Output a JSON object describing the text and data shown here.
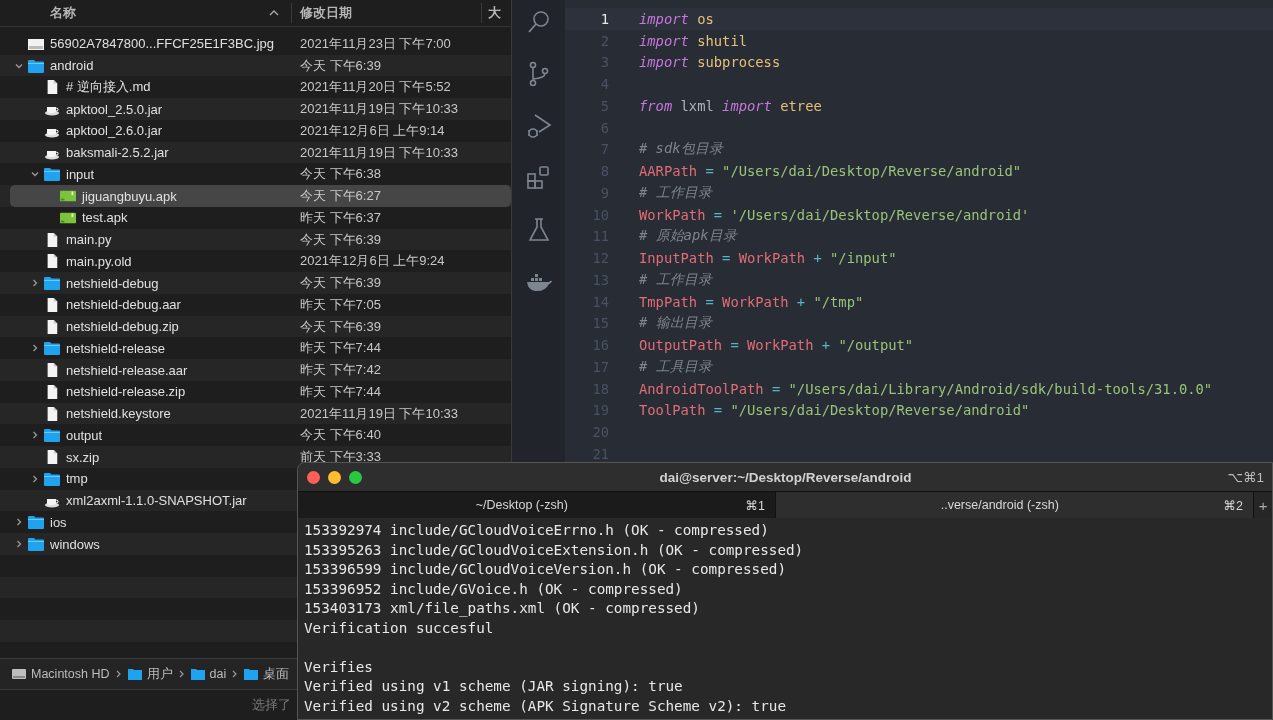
{
  "finder": {
    "columns": [
      {
        "label": "名称",
        "sorted": true
      },
      {
        "label": "修改日期",
        "sorted": false
      },
      {
        "label": "大",
        "sorted": false
      }
    ],
    "rows": [
      {
        "name": "56902A7847800...FFCF25E1F3BC.jpg",
        "date": "2021年11月23日 下午7:00",
        "kind": "image",
        "selected": false
      },
      {
        "name": "android",
        "date": "今天 下午6:39",
        "kind": "folder",
        "expanded": true,
        "selected": false,
        "children": [
          {
            "name": "# 逆向接入.md",
            "date": "2021年11月20日 下午5:52",
            "kind": "document",
            "selected": false
          },
          {
            "name": "apktool_2.5.0.jar",
            "date": "2021年11月19日 下午10:33",
            "kind": "jar",
            "selected": false
          },
          {
            "name": "apktool_2.6.0.jar",
            "date": "2021年12月6日 上午9:14",
            "kind": "jar",
            "selected": false
          },
          {
            "name": "baksmali-2.5.2.jar",
            "date": "2021年11月19日 下午10:33",
            "kind": "jar",
            "selected": false
          },
          {
            "name": "input",
            "date": "今天 下午6:38",
            "kind": "folder",
            "expanded": true,
            "selected": false,
            "children": [
              {
                "name": "jiguangbuyu.apk",
                "date": "今天 下午6:27",
                "kind": "apk",
                "selected": true
              },
              {
                "name": "test.apk",
                "date": "昨天 下午6:37",
                "kind": "apk",
                "selected": false
              }
            ]
          },
          {
            "name": "main.py",
            "date": "今天 下午6:39",
            "kind": "document",
            "selected": false
          },
          {
            "name": "main.py.old",
            "date": "2021年12月6日 上午9:24",
            "kind": "document",
            "selected": false
          },
          {
            "name": "netshield-debug",
            "date": "今天 下午6:39",
            "kind": "folder",
            "expanded": false,
            "selected": false
          },
          {
            "name": "netshield-debug.aar",
            "date": "昨天 下午7:05",
            "kind": "document",
            "selected": false
          },
          {
            "name": "netshield-debug.zip",
            "date": "今天 下午6:39",
            "kind": "document",
            "selected": false
          },
          {
            "name": "netshield-release",
            "date": "昨天 下午7:44",
            "kind": "folder",
            "expanded": false,
            "selected": false
          },
          {
            "name": "netshield-release.aar",
            "date": "昨天 下午7:42",
            "kind": "document",
            "selected": false
          },
          {
            "name": "netshield-release.zip",
            "date": "昨天 下午7:44",
            "kind": "document",
            "selected": false
          },
          {
            "name": "netshield.keystore",
            "date": "2021年11月19日 下午10:33",
            "kind": "document",
            "selected": false
          },
          {
            "name": "output",
            "date": "今天 下午6:40",
            "kind": "folder",
            "expanded": false,
            "selected": false
          },
          {
            "name": "sx.zip",
            "date": "前天 下午3:33",
            "kind": "document",
            "selected": false
          },
          {
            "name": "tmp",
            "kind": "folder",
            "expanded": false,
            "selected": false
          },
          {
            "name": "xml2axml-1.1.0-SNAPSHOT.jar",
            "kind": "jar",
            "selected": false
          }
        ]
      },
      {
        "name": "ios",
        "kind": "folder",
        "expanded": false,
        "selected": false
      },
      {
        "name": "windows",
        "kind": "folder",
        "expanded": false,
        "selected": false
      }
    ],
    "path_bar": [
      {
        "label": "Macintosh HD",
        "kind": "disk"
      },
      {
        "label": "用户",
        "kind": "folder"
      },
      {
        "label": "dai",
        "kind": "folder"
      },
      {
        "label": "桌面",
        "kind": "folder"
      }
    ],
    "status": "选择了"
  },
  "editor": {
    "lines": [
      {
        "number": "1",
        "current": true,
        "tokens": [
          {
            "kind": "kw",
            "text": "import"
          },
          {
            "kind": "mod",
            "text": " os"
          }
        ]
      },
      {
        "number": "2",
        "current": false,
        "tokens": [
          {
            "kind": "kw",
            "text": "import"
          },
          {
            "kind": "mod",
            "text": " shutil"
          }
        ]
      },
      {
        "number": "3",
        "current": false,
        "tokens": [
          {
            "kind": "kw",
            "text": "import"
          },
          {
            "kind": "mod",
            "text": " subprocess"
          }
        ]
      },
      {
        "number": "4",
        "current": false
      },
      {
        "number": "5",
        "current": false,
        "tokens": [
          {
            "kind": "kw",
            "text": "from"
          },
          {
            "kind": "plain",
            "text": " lxml "
          },
          {
            "kind": "kw",
            "text": "import"
          },
          {
            "kind": "mod",
            "text": " etree"
          }
        ]
      },
      {
        "number": "6",
        "current": false
      },
      {
        "number": "7",
        "current": false,
        "tokens": [
          {
            "kind": "comment",
            "text": "# sdk包目录"
          }
        ]
      },
      {
        "number": "8",
        "current": false,
        "tokens": [
          {
            "kind": "var",
            "text": "AARPath"
          },
          {
            "kind": "op",
            "text": " = "
          },
          {
            "kind": "str",
            "text": "\"/Users/dai/Desktop/Reverse/android\""
          }
        ]
      },
      {
        "number": "9",
        "current": false,
        "tokens": [
          {
            "kind": "comment",
            "text": "# 工作目录"
          }
        ]
      },
      {
        "number": "10",
        "current": false,
        "tokens": [
          {
            "kind": "var",
            "text": "WorkPath"
          },
          {
            "kind": "op",
            "text": " = "
          },
          {
            "kind": "str",
            "text": "'/Users/dai/Desktop/Reverse/android'"
          }
        ]
      },
      {
        "number": "11",
        "current": false,
        "tokens": [
          {
            "kind": "comment",
            "text": "# 原始apk目录"
          }
        ]
      },
      {
        "number": "12",
        "current": false,
        "tokens": [
          {
            "kind": "var",
            "text": "InputPath"
          },
          {
            "kind": "op",
            "text": " = "
          },
          {
            "kind": "var",
            "text": "WorkPath"
          },
          {
            "kind": "op",
            "text": " + "
          },
          {
            "kind": "str",
            "text": "\"/input\""
          }
        ]
      },
      {
        "number": "13",
        "current": false,
        "tokens": [
          {
            "kind": "comment",
            "text": "# 工作目录"
          }
        ]
      },
      {
        "number": "14",
        "current": false,
        "tokens": [
          {
            "kind": "var",
            "text": "TmpPath"
          },
          {
            "kind": "op",
            "text": " = "
          },
          {
            "kind": "var",
            "text": "WorkPath"
          },
          {
            "kind": "op",
            "text": " + "
          },
          {
            "kind": "str",
            "text": "\"/tmp\""
          }
        ]
      },
      {
        "number": "15",
        "current": false,
        "tokens": [
          {
            "kind": "comment",
            "text": "# 输出目录"
          }
        ]
      },
      {
        "number": "16",
        "current": false,
        "tokens": [
          {
            "kind": "var",
            "text": "OutputPath"
          },
          {
            "kind": "op",
            "text": " = "
          },
          {
            "kind": "var",
            "text": "WorkPath"
          },
          {
            "kind": "op",
            "text": " + "
          },
          {
            "kind": "str",
            "text": "\"/output\""
          }
        ]
      },
      {
        "number": "17",
        "current": false,
        "tokens": [
          {
            "kind": "comment",
            "text": "# 工具目录"
          }
        ]
      },
      {
        "number": "18",
        "current": false,
        "tokens": [
          {
            "kind": "var",
            "text": "AndroidToolPath"
          },
          {
            "kind": "op",
            "text": " = "
          },
          {
            "kind": "str",
            "text": "\"/Users/dai/Library/Android/sdk/build-tools/31.0.0\""
          }
        ]
      },
      {
        "number": "19",
        "current": false,
        "tokens": [
          {
            "kind": "var",
            "text": "ToolPath"
          },
          {
            "kind": "op",
            "text": " = "
          },
          {
            "kind": "str",
            "text": "\"/Users/dai/Desktop/Reverse/android\""
          }
        ]
      },
      {
        "number": "20",
        "current": false
      },
      {
        "number": "21",
        "current": false
      }
    ]
  },
  "terminal": {
    "title": "dai@server:~/Desktop/Reverse/android",
    "shortcut": "⌥⌘1",
    "tabs": [
      {
        "label": "~/Desktop (-zsh)",
        "shortcut": "⌘1",
        "selected": false
      },
      {
        "label": "..verse/android (-zsh)",
        "shortcut": "⌘2",
        "selected": true
      }
    ],
    "new_tab": "+",
    "output": [
      [
        "153392974 include/GCloudVoiceErrno.h (OK - compressed)",
        "153395263 include/GCloudVoiceExtension.h (OK - compressed)",
        "153396599 include/GCloudVoiceVersion.h (OK - compressed)",
        "153396952 include/GVoice.h (OK - compressed)",
        "153403173 xml/file_paths.xml (OK - compressed)",
        "Verification succesful"
      ],
      [
        "Verifies",
        "Verified using v1 scheme (JAR signing): true",
        "Verified using v2 scheme (APK Signature Scheme v2): true"
      ]
    ]
  }
}
